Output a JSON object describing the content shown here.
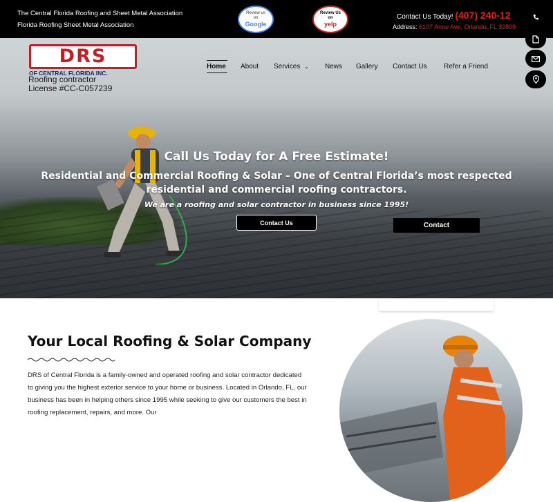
{
  "topbar": {
    "association_line1": "The Central Florida Roofing and Sheet Metal Association",
    "association_line2": "Florida Roofing Sheet Metal Association",
    "google_badge": {
      "top": "Review us",
      "mid": "on",
      "brand": "Google"
    },
    "yelp_badge": {
      "top": "Review Us",
      "mid": "on",
      "brand": "yelp"
    },
    "contact_label": "Contact Us Today!",
    "phone": "(407) 240-12",
    "address_label": "Address:",
    "address_value": "6107 Anne Ave, Orlando, FL 32809"
  },
  "logo": {
    "text": "DRS",
    "sub": "OF CENTRAL FLORIDA INC.",
    "note1": "Roofing contractor",
    "note2": "License #CC-C057239"
  },
  "nav": {
    "items": [
      {
        "label": "Home",
        "active": true
      },
      {
        "label": "About"
      },
      {
        "label": "Services",
        "has_dropdown": true
      },
      {
        "label": "News"
      },
      {
        "label": "Gallery"
      },
      {
        "label": "Contact Us"
      },
      {
        "label": "Refer a Friend"
      }
    ]
  },
  "side_buttons": [
    "phone-icon",
    "document-icon",
    "envelope-icon",
    "location-pin-icon"
  ],
  "hero": {
    "title": "Call Us Today for A Free Estimate!",
    "subtitle": "Residential and Commercial Roofing & Solar – One of Central Florida’s most respected residential and commercial roofing contractors.",
    "tagline": "We are a roofing and solar contractor in business since 1995!",
    "button_contact_us": "Contact Us",
    "button_contact": "Contact"
  },
  "section": {
    "title": "Your Local Roofing & Solar Company",
    "body": "DRS of Central Florida is a family-owned and operated roofing and solar contractor dedicated to giving you the highest exterior service to your home or business. Located in Orlando, FL, our business has been in helping others since 1995 while seeking to give our customers the best in roofing replacement, repairs, and more. Our"
  },
  "colors": {
    "accent_red": "#e02020",
    "logo_red": "#c41e24",
    "logo_navy": "#1a2a6c"
  }
}
